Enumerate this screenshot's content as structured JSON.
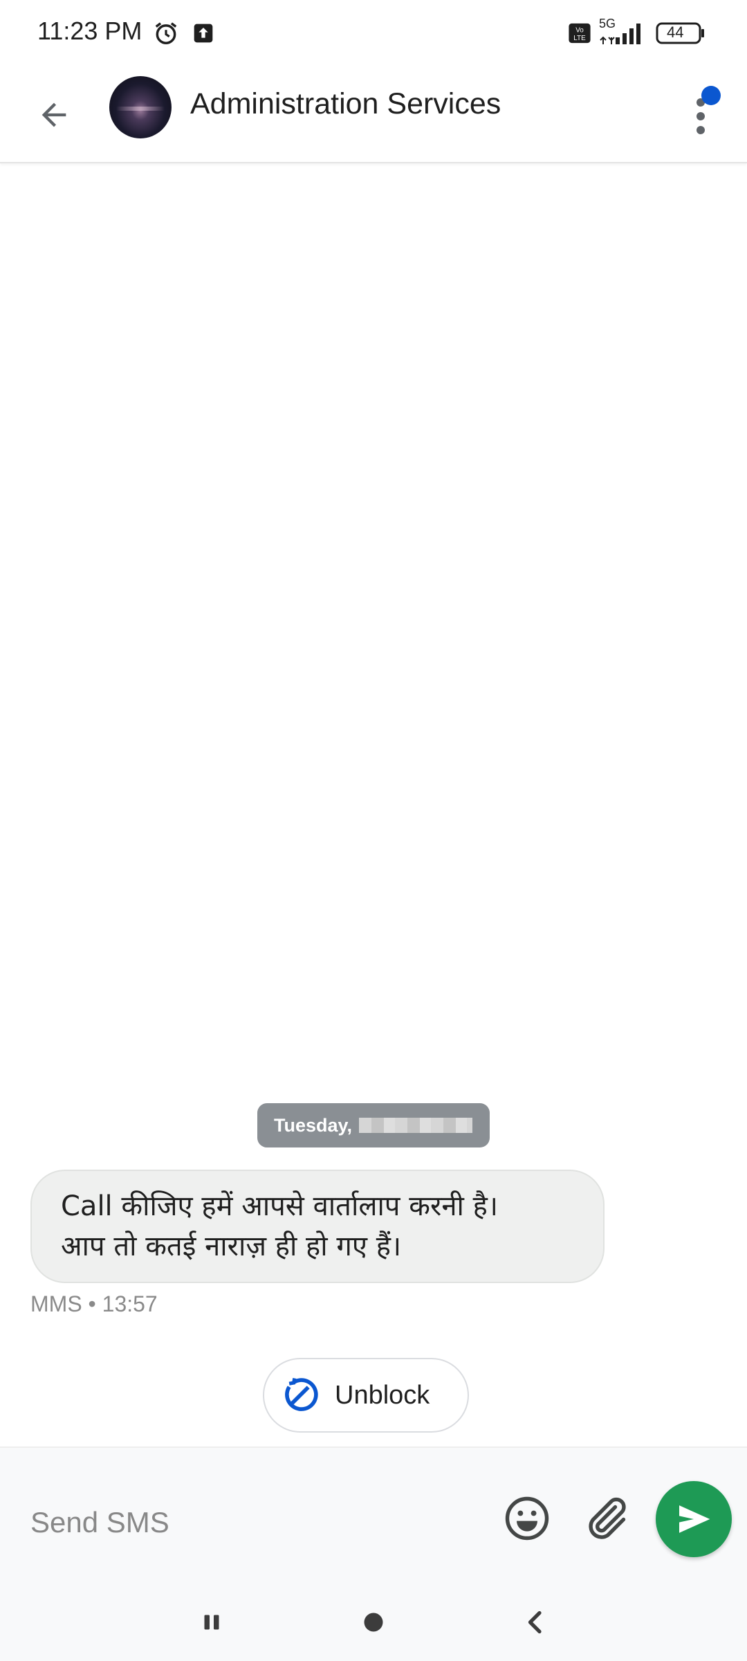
{
  "status_bar": {
    "time": "11:23 PM",
    "network": "5G",
    "battery": "44",
    "icons": [
      "alarm-icon",
      "upload-icon",
      "volte-icon",
      "signal-icon",
      "battery-icon"
    ]
  },
  "header": {
    "contact_name": "Administration Services",
    "icons": [
      "back-arrow-icon",
      "avatar",
      "more-vert-icon"
    ],
    "notification_dot_color": "#0b57d0"
  },
  "conversation": {
    "date_label": "Tuesday,",
    "message": {
      "lines": [
        "Call कीजिए हमें आपसे वार्तालाप करनी है।",
        "आप तो कतई नाराज़ ही हो गए हैं।"
      ],
      "meta": "MMS • 13:57"
    },
    "unblock_label": "Unblock"
  },
  "compose": {
    "placeholder": "Send SMS",
    "icons": [
      "emoji-icon",
      "attach-icon",
      "send-icon"
    ],
    "send_color": "#1e9a55"
  },
  "nav": {
    "icons": [
      "recents-icon",
      "home-icon",
      "back-nav-icon"
    ]
  }
}
